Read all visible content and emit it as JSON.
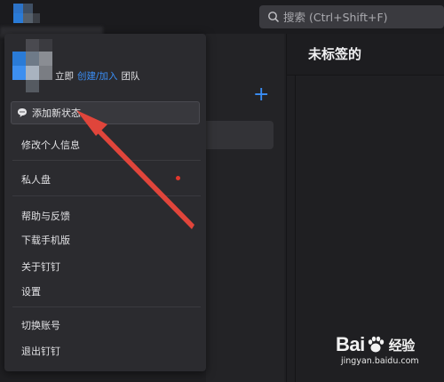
{
  "search": {
    "placeholder": "搜索 (Ctrl+Shift+F)"
  },
  "main": {
    "title": "未标签的"
  },
  "profile": {
    "team_prompt_prefix": "立即",
    "team_prompt_link": "创建/加入",
    "team_prompt_suffix": "团队"
  },
  "menu": {
    "status_label": "添加新状态",
    "items": [
      {
        "label": "修改个人信息"
      },
      {
        "label": "私人盘"
      },
      {
        "label": "帮助与反馈"
      },
      {
        "label": "下载手机版"
      },
      {
        "label": "关于钉钉"
      },
      {
        "label": "设置"
      },
      {
        "label": "切换账号"
      },
      {
        "label": "退出钉钉"
      }
    ]
  },
  "watermark": {
    "logo_text_a": "Bai",
    "logo_text_b": "经验",
    "url": "jingyan.baidu.com"
  },
  "colors": {
    "accent": "#3a8ef6",
    "arrow": "#e0453b",
    "notification_dot": "#e0382d"
  }
}
